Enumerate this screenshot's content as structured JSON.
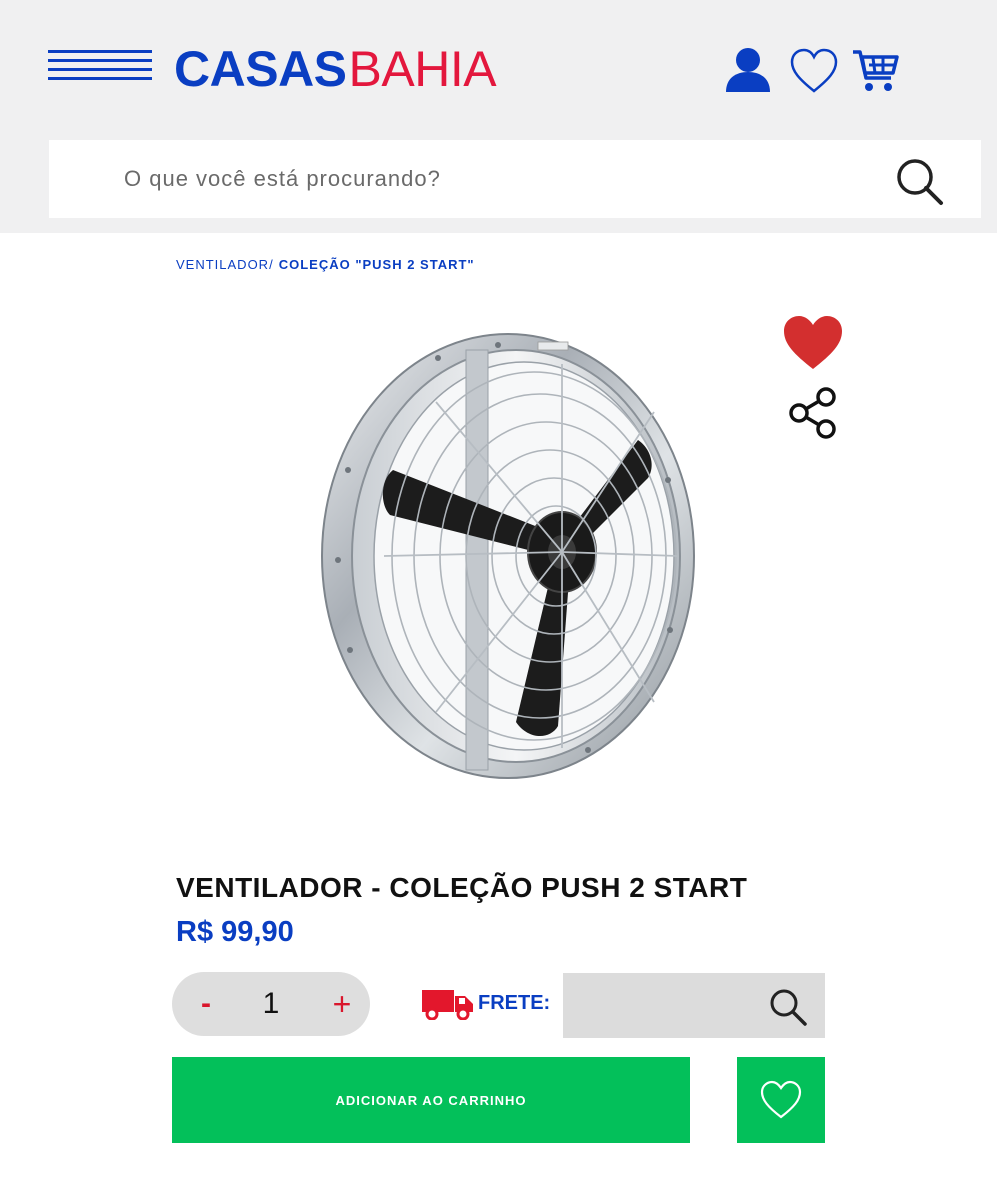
{
  "brand": {
    "name_part1": "CASAS",
    "name_part2": "BAHIA",
    "primary_color": "#0a3ec2",
    "accent_color": "#e3173d"
  },
  "header": {
    "icons": [
      "menu-icon",
      "user-icon",
      "heart-icon",
      "cart-icon"
    ]
  },
  "search": {
    "placeholder": "O que você está procurando?",
    "icon": "search-icon"
  },
  "breadcrumb": {
    "items": [
      {
        "label": "VENTILADOR"
      },
      {
        "label": "COLEÇÃO \"PUSH 2 START\""
      }
    ],
    "separator": "/"
  },
  "product": {
    "image_icon": "industrial-fan-image",
    "favorite_color": "#d32f2f",
    "title": "VENTILADOR - COLEÇÃO PUSH 2 START",
    "price": "R$ 99,90"
  },
  "quantity": {
    "minus_label": "-",
    "value": "1",
    "plus_label": "+"
  },
  "shipping": {
    "label": "FRETE:",
    "icon": "truck-icon",
    "input_value": ""
  },
  "actions": {
    "add_to_cart_label": "ADICIONAR AO CARRINHO",
    "button_color": "#03c05a",
    "wishlist_icon": "heart-outline-icon"
  }
}
